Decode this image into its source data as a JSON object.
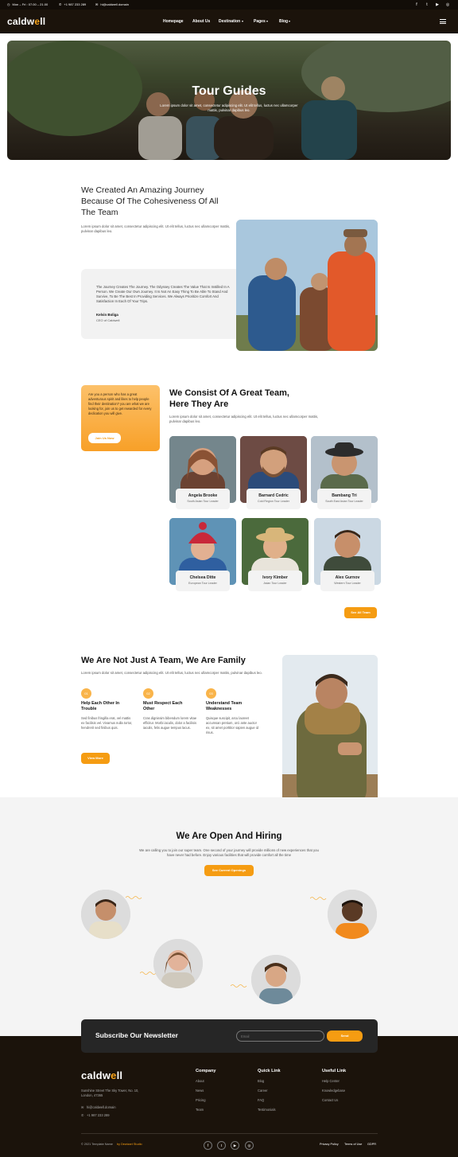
{
  "topbar": {
    "hours": "Mon – Fri : 07.00 – 21.00",
    "phone": "+1 987 233 289",
    "email": "hi@caldwell.domain",
    "social_icons": [
      "facebook-icon",
      "twitter-icon",
      "youtube-icon",
      "instagram-icon"
    ]
  },
  "brand": {
    "logo_text": "caldwell"
  },
  "nav": {
    "items": [
      "Homepage",
      "About Us",
      "Destination",
      "Pages",
      "Blog"
    ]
  },
  "hero": {
    "title": "Tour Guides",
    "subtitle": "Lorem ipsum dolor sit amet, consectetur adipiscing elit. Ut elit tellus, luctus nec ullamcorper mattis, pulvinar dapibus leo."
  },
  "journey": {
    "heading": "We Created An Amazing Journey Because Of The Cohesiveness Of All The Team",
    "text": "Lorem ipsum dolor sit amet, consectetur adipiscing elit. Ut elit tellus, luctus nec ullamcorper mattis, pulvinar dapibus leo.",
    "quote": "The Journey Creates The Journey. The Odyssey Creates The Value That Is Instilled In A Person. We Create Our Own Journey. It Is Not An Easy Thing To Be Able To Stand And Survive, To Be The Best In Providing Services. We Always Prioritize Comfort And Satisfaction In Each Of Your Trips.",
    "author": "Kelvin Boliga",
    "author_role": "CEO of Caldwell"
  },
  "team": {
    "promo_text": "Are you a person who has a great adventurous spirit and likes to help people find their destination? you are what we are looking for, join us to get rewarded for every dedication you will give.",
    "promo_button": "Join Us Now",
    "heading": "We Consist Of A Great Team, Here They Are",
    "text": "Lorem ipsum dolor sit amet, consectetur adipiscing elit. Ut elit tellus, luctus nec ullamcorper mattis, pulvinar dapibus leo.",
    "members": [
      {
        "name": "Angela Brooke",
        "role": "South Asian Tour Leader"
      },
      {
        "name": "Barnard Cedric",
        "role": "Cold Region Tour Leader"
      },
      {
        "name": "Bambang Tri",
        "role": "South East Asian Tour Leader"
      },
      {
        "name": "Chelsea Ditte",
        "role": "European Tour Leader"
      },
      {
        "name": "Ivory Kimber",
        "role": "Asian Tour Leader"
      },
      {
        "name": "Alex Gurnov",
        "role": "Western Tour Leader"
      }
    ],
    "see_all": "See All Team"
  },
  "family": {
    "heading": "We Are Not Just A Team, We Are Family",
    "text": "Lorem ipsum dolor sit amet, consectetur adipiscing elit. Ut elit tellus, luctus nec ullamcorper mattis, pulvinar dapibus leo.",
    "features": [
      {
        "num": "01",
        "title": "Help Each Other In Trouble",
        "desc": "Sed finibus fringilla erat, vel mattis ex facilisis vel. Vivamus nulla tortor, hendrerit sed finibus quis."
      },
      {
        "num": "02",
        "title": "Must Respect Each Other",
        "desc": "Cras dignissim bibendum lorem vitae efficitur. Morbi iaculis, dolor a facilisis iaculis, felis augue tempus lacus."
      },
      {
        "num": "03",
        "title": "Understand Team Weaknesses",
        "desc": "Quisque suscipit, arcu laoreet accumsan pretium, orci ante auctor ex, sit amet porttitor sapien augue id risus."
      }
    ],
    "button": "View More"
  },
  "hiring": {
    "heading": "We Are Open And Hiring",
    "text": "We are calling you to join our super team. One second of your journey will provide millions of new experiences that you have never had before. Enjoy various facilities that will provide comfort all the time",
    "button": "See Current Openings"
  },
  "newsletter": {
    "heading": "Subscribe Our Newsletter",
    "placeholder": "Email",
    "button": "Send"
  },
  "footer": {
    "logo_text": "caldwell",
    "address": "Sunshine Street The Sky Tower, No. 10, London, 47365",
    "email": "hi@caldwell.domain",
    "phone": "+1 987 233 289",
    "columns": [
      {
        "title": "Company",
        "links": [
          "About",
          "News",
          "Pricing",
          "Team"
        ]
      },
      {
        "title": "Quick Link",
        "links": [
          "Blog",
          "Career",
          "FAQ",
          "Testimonials"
        ]
      },
      {
        "title": "Useful Link",
        "links": [
          "Help Center",
          "Knowledgebase",
          "Contact Us"
        ]
      }
    ],
    "copyright": "© 2021 Template Name",
    "credit": "by Dewizart Studio",
    "social_icons": [
      "facebook-icon",
      "twitter-icon",
      "youtube-icon",
      "instagram-icon"
    ],
    "legal": [
      "Privacy Policy",
      "Terms of Use",
      "GDPR"
    ]
  },
  "colors": {
    "accent": "#f59c12",
    "dark": "#1b130b"
  }
}
